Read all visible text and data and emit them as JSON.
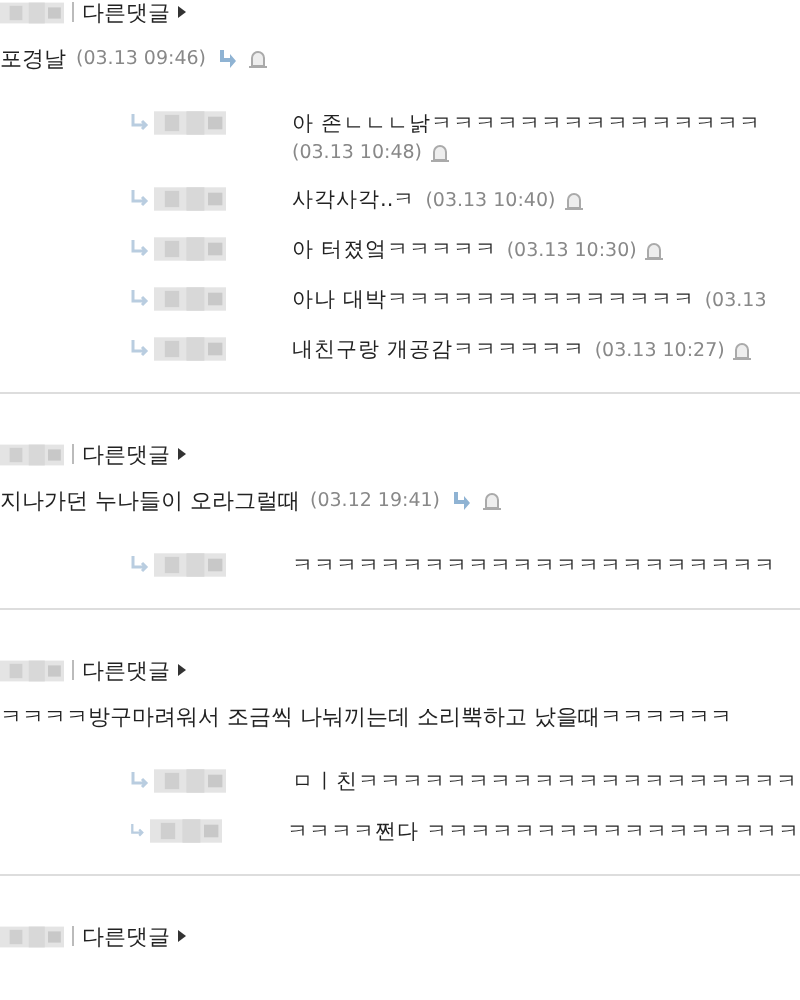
{
  "comments": [
    {
      "other_link": "다른댓글",
      "text": "포경날",
      "time": "(03.13 09:46)",
      "replies": [
        {
          "text": "아 존ㄴㄴㄴ낡ㅋㅋㅋㅋㅋㅋㅋㅋㅋㅋㅋㅋㅋㅋㅋ",
          "time": "(03.13 10:48)",
          "report": true
        },
        {
          "text": "사각사각..ㅋ",
          "time": "(03.13 10:40)",
          "report": true
        },
        {
          "text": "아 터졌엌ㅋㅋㅋㅋㅋ",
          "time": "(03.13 10:30)",
          "report": true
        },
        {
          "text": "아나 대박ㅋㅋㅋㅋㅋㅋㅋㅋㅋㅋㅋㅋㅋㅋ",
          "time": "(03.13"
        },
        {
          "text": "내친구랑 개공감ㅋㅋㅋㅋㅋㅋ",
          "time": "(03.13 10:27)",
          "report": true
        }
      ]
    },
    {
      "other_link": "다른댓글",
      "text": "지나가던 누나들이 오라그럴때",
      "time": "(03.12 19:41)",
      "replies": [
        {
          "text": "ㅋㅋㅋㅋㅋㅋㅋㅋㅋㅋㅋㅋㅋㅋㅋㅋㅋㅋㅋㅋㅋㅋ"
        }
      ]
    },
    {
      "other_link": "다른댓글",
      "text": "ㅋㅋㅋㅋ방구마려워서 조금씩 나눠끼는데 소리뿍하고 났을때ㅋㅋㅋㅋㅋㅋ",
      "replies": [
        {
          "text": "ㅁㅣ친ㅋㅋㅋㅋㅋㅋㅋㅋㅋㅋㅋㅋㅋㅋㅋㅋㅋㅋㅋㅋ"
        },
        {
          "text": "ㅋㅋㅋㅋ쩐다 ㅋㅋㅋㅋㅋㅋㅋㅋㅋㅋㅋㅋㅋㅋㅋㅋㅋ"
        }
      ]
    },
    {
      "other_link": "다른댓글"
    }
  ]
}
